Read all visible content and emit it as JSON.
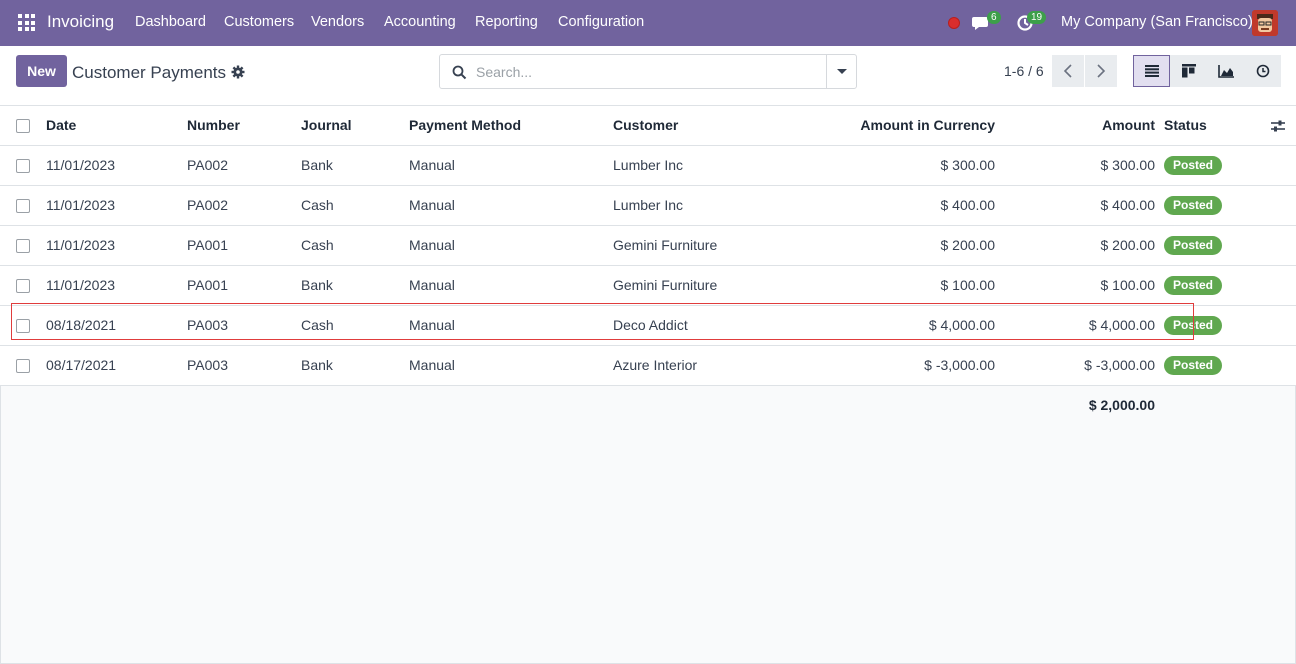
{
  "navbar": {
    "app_name": "Invoicing",
    "menu": [
      "Dashboard",
      "Customers",
      "Vendors",
      "Accounting",
      "Reporting",
      "Configuration"
    ],
    "messages_count": "6",
    "activities_count": "19",
    "company": "My Company (San Francisco)",
    "accent_color": "#71639e"
  },
  "control": {
    "new_label": "New",
    "title": "Customer Payments",
    "search_placeholder": "Search...",
    "pager": "1-6 / 6"
  },
  "table": {
    "headers": {
      "date": "Date",
      "number": "Number",
      "journal": "Journal",
      "method": "Payment Method",
      "customer": "Customer",
      "amount_currency": "Amount in Currency",
      "amount": "Amount",
      "status": "Status"
    },
    "rows": [
      {
        "date": "11/01/2023",
        "number": "PA002",
        "journal": "Bank",
        "method": "Manual",
        "customer": "Lumber Inc",
        "amount_currency": "$ 300.00",
        "amount": "$ 300.00",
        "status": "Posted"
      },
      {
        "date": "11/01/2023",
        "number": "PA002",
        "journal": "Cash",
        "method": "Manual",
        "customer": "Lumber Inc",
        "amount_currency": "$ 400.00",
        "amount": "$ 400.00",
        "status": "Posted"
      },
      {
        "date": "11/01/2023",
        "number": "PA001",
        "journal": "Cash",
        "method": "Manual",
        "customer": "Gemini Furniture",
        "amount_currency": "$ 200.00",
        "amount": "$ 200.00",
        "status": "Posted"
      },
      {
        "date": "11/01/2023",
        "number": "PA001",
        "journal": "Bank",
        "method": "Manual",
        "customer": "Gemini Furniture",
        "amount_currency": "$ 100.00",
        "amount": "$ 100.00",
        "status": "Posted"
      },
      {
        "date": "08/18/2021",
        "number": "PA003",
        "journal": "Cash",
        "method": "Manual",
        "customer": "Deco Addict",
        "amount_currency": "$ 4,000.00",
        "amount": "$ 4,000.00",
        "status": "Posted"
      },
      {
        "date": "08/17/2021",
        "number": "PA003",
        "journal": "Bank",
        "method": "Manual",
        "customer": "Azure Interior",
        "amount_currency": "$ -3,000.00",
        "amount": "$ -3,000.00",
        "status": "Posted"
      }
    ],
    "total_amount": "$ 2,000.00",
    "status_color": "#60a84f",
    "highlight_color": "#e03c3c"
  }
}
